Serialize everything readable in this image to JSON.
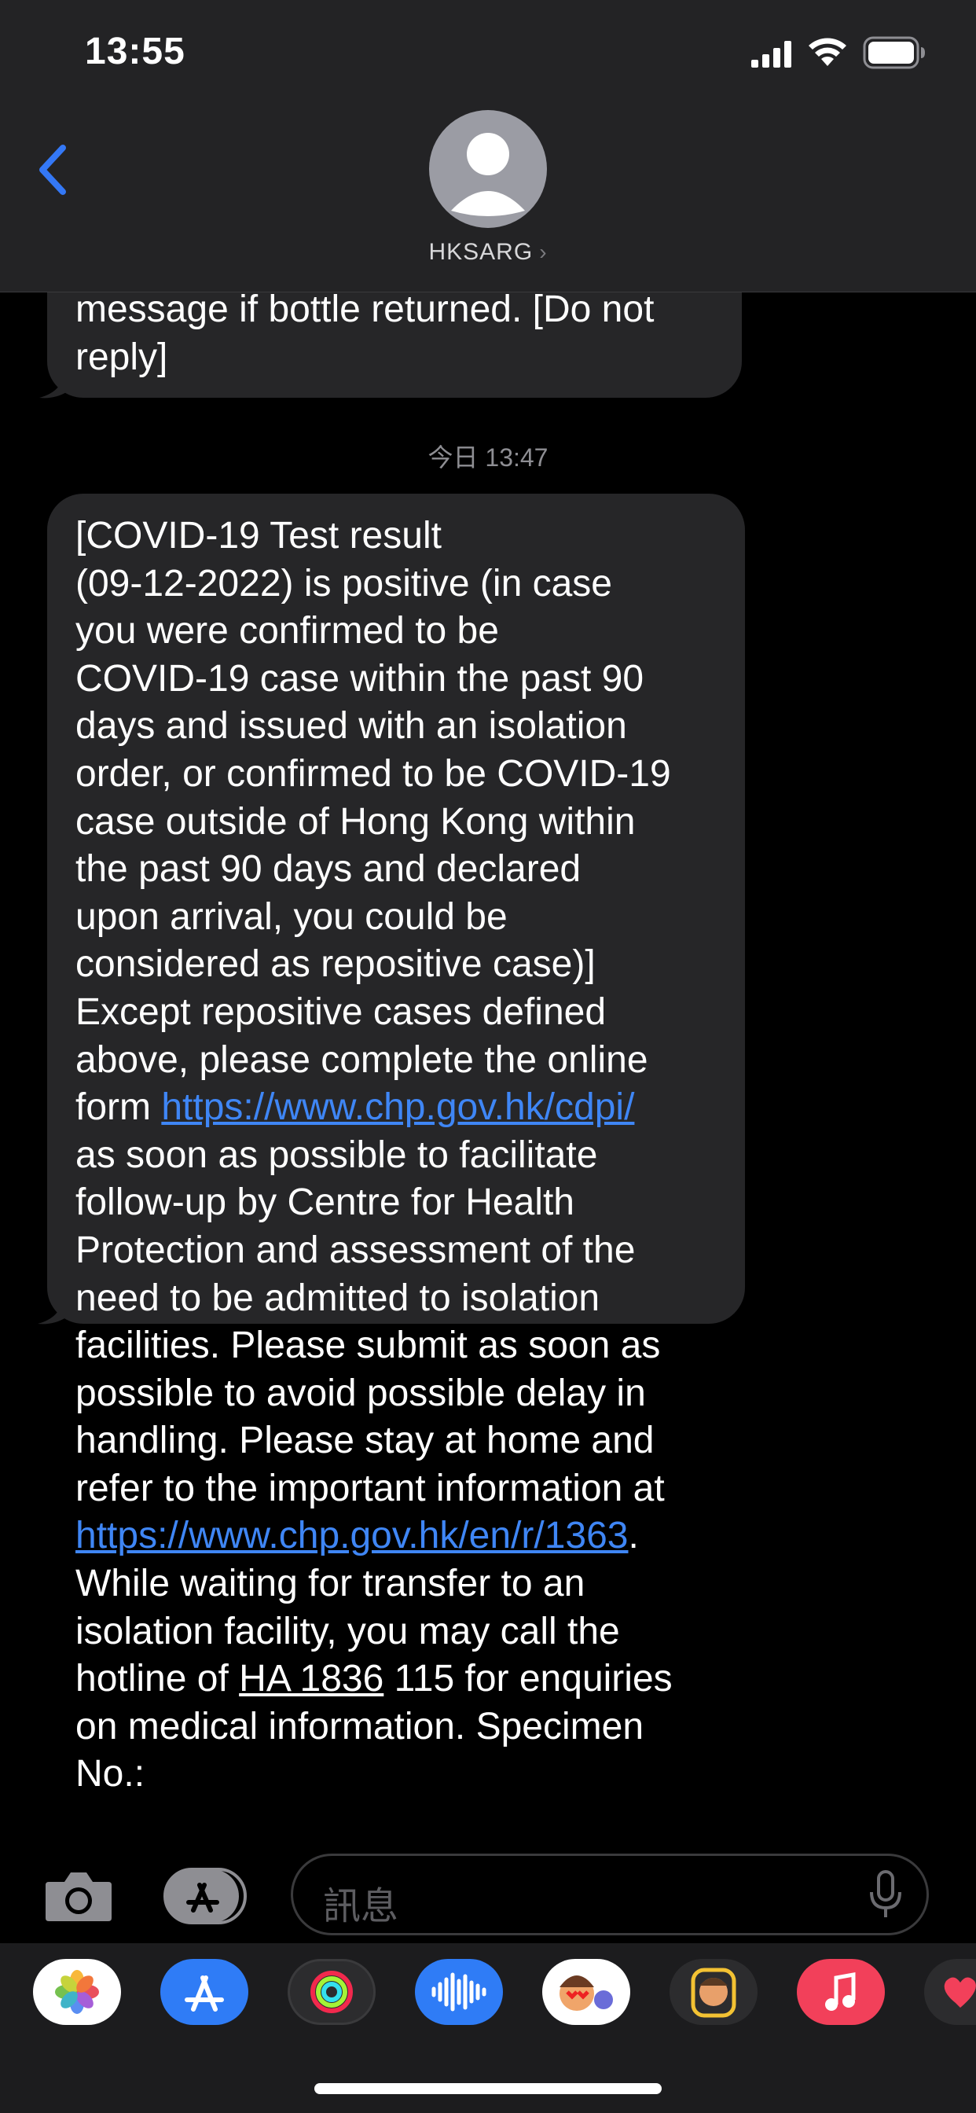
{
  "status_bar": {
    "time": "13:55"
  },
  "contact": {
    "name": "HKSARG",
    "chevron": "›"
  },
  "messages": {
    "previous_line1": "message if bottle returned. [Do not",
    "previous_line2": "reply]",
    "timestamp": "今日 13:47",
    "main": {
      "part1": "[COVID-19 Test result\n(09-12-2022) is positive (in case\nyou were confirmed to be\nCOVID-19 case within the past 90\ndays and issued with an isolation\norder, or confirmed to be COVID-19\ncase outside of Hong Kong within\nthe past 90 days and declared\nupon arrival, you could be\nconsidered as repositive case)]\nExcept repositive cases defined\nabove, please complete the online\nform ",
      "link1": "https://www.chp.gov.hk/cdpi/",
      "part2": "\nas soon as possible to facilitate\nfollow-up by Centre for Health\nProtection and assessment of the\nneed to be admitted to isolation\nfacilities. Please submit as soon as\npossible to avoid possible delay in\nhandling. Please stay at home and\nrefer to the important information at\n",
      "link2": "https://www.chp.gov.hk/en/r/1363",
      "part3": ".\nWhile waiting for transfer to an\nisolation facility, you may call the\nhotline of ",
      "hotline": "HA 1836",
      "part4": " 115 for enquiries\non medical information. Specimen\nNo.:"
    }
  },
  "composer": {
    "placeholder": "訊息"
  },
  "app_drawer": {
    "apps": [
      "photos-icon",
      "app-store-icon",
      "activity-icon",
      "audio-message-icon",
      "memoji-stickers-icon",
      "memoji-icon",
      "music-icon",
      "digital-touch-icon"
    ]
  },
  "colors": {
    "link": "#3f86f5",
    "bubble": "#262628",
    "header": "#232325",
    "accent_blue": "#3478f6"
  }
}
